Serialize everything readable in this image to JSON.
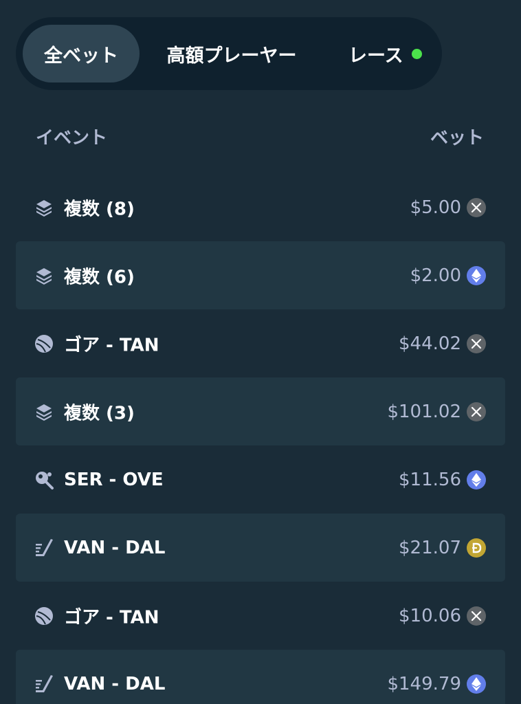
{
  "tabs": {
    "all_bets": "全ベット",
    "high_rollers": "高額プレーヤー",
    "race": "レース",
    "active_tab": "all_bets",
    "live_dot_color": "#4be14b"
  },
  "columns": {
    "event": "イベント",
    "bet": "ベット"
  },
  "bets": [
    {
      "icon": "layers-icon",
      "event": "複数 (8)",
      "amount": "$5.00",
      "currency": "xrp-coin-icon"
    },
    {
      "icon": "layers-icon",
      "event": "複数 (6)",
      "amount": "$2.00",
      "currency": "eth-coin-icon"
    },
    {
      "icon": "rugby-ball-icon",
      "event": "ゴア - TAN",
      "amount": "$44.02",
      "currency": "xrp-coin-icon"
    },
    {
      "icon": "layers-icon",
      "event": "複数 (3)",
      "amount": "$101.02",
      "currency": "xrp-coin-icon"
    },
    {
      "icon": "table-tennis-icon",
      "event": "SER - OVE",
      "amount": "$11.56",
      "currency": "eth-coin-icon"
    },
    {
      "icon": "hockey-stick-icon",
      "event": "VAN - DAL",
      "amount": "$21.07",
      "currency": "doge-coin-icon"
    },
    {
      "icon": "rugby-ball-icon",
      "event": "ゴア - TAN",
      "amount": "$10.06",
      "currency": "xrp-coin-icon"
    },
    {
      "icon": "hockey-stick-icon",
      "event": "VAN - DAL",
      "amount": "$149.79",
      "currency": "eth-coin-icon"
    }
  ],
  "colors": {
    "background": "#1a2c38",
    "tab_bar": "#0f212e",
    "active_tab": "#2f4553",
    "alt_row": "#213743",
    "muted_text": "#b1bad3",
    "eth": "#627eea",
    "doge": "#c2a633",
    "xrp": "#5f6468"
  }
}
